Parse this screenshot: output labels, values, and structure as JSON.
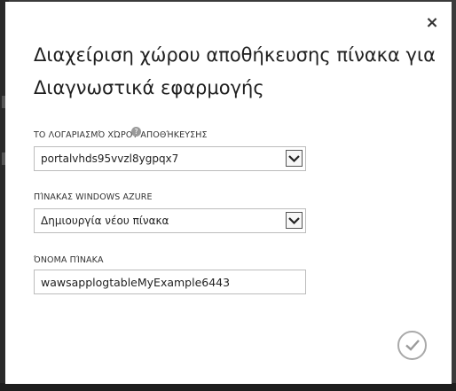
{
  "dialog": {
    "title_line1": "Διαχείριση χώρου αποθήκευσης πίνακα για",
    "title_line2": "Διαγνωστικά εφαρμογής",
    "close_glyph": "×"
  },
  "fields": {
    "storage_account": {
      "label": "ΤΟ ΛΟΓΑΡΙΑΣΜΌ ΧΏΡΟΥ ΑΠΟΘΉΚΕΥΣΗΣ",
      "value": "portalvhds95vvzl8ygpqx7"
    },
    "azure_table": {
      "label": "ΠΊΝΑΚΑΣ WINDOWS AZURE",
      "value": "Δημιουργία νέου πίνακα"
    },
    "table_name": {
      "label": "ΌΝΟΜΑ ΠΊΝΑΚΑ",
      "value": "wawsapplogtableMyExample6443"
    }
  },
  "icons": {
    "close": "close-icon",
    "dropdown": "chevron-down-icon",
    "confirm": "checkmark-icon",
    "help": "help-icon"
  }
}
